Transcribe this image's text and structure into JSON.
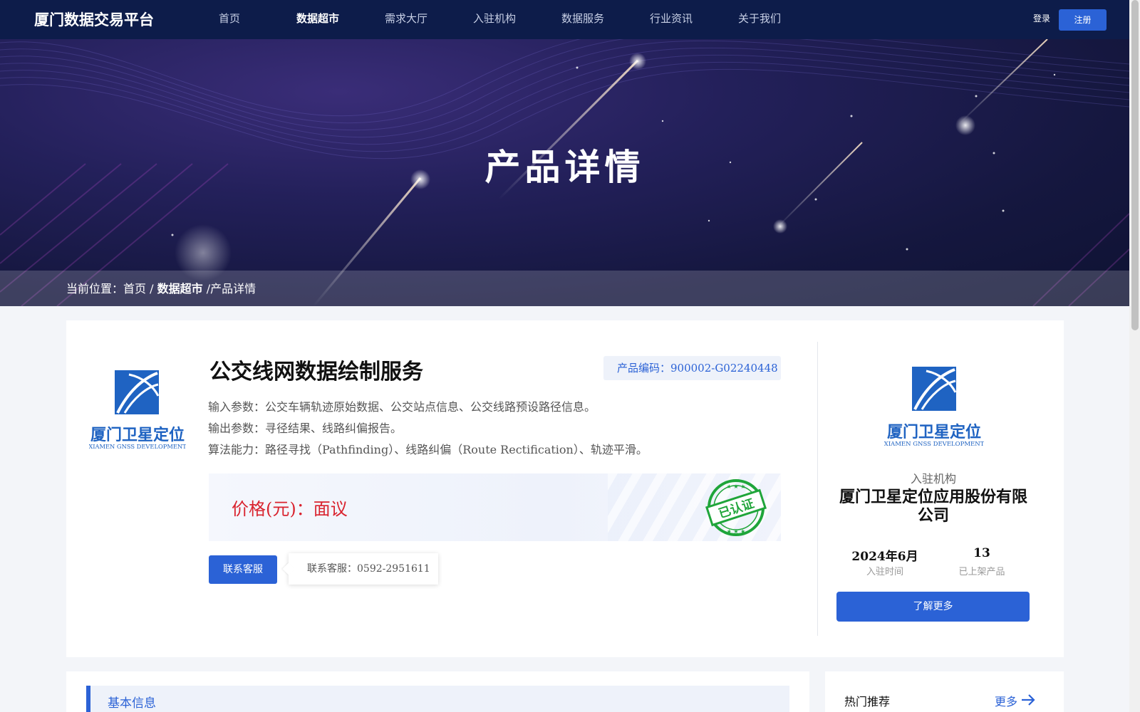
{
  "nav": {
    "brand": "厦门数据交易平台",
    "items": [
      "首页",
      "数据超市",
      "需求大厅",
      "入驻机构",
      "数据服务",
      "行业资讯",
      "关于我们"
    ],
    "active_index": 1,
    "login": "登录",
    "register": "注册"
  },
  "hero": {
    "title": "产品详情"
  },
  "breadcrumb": {
    "prefix": "当前位置：",
    "home": "首页",
    "sep1": "/",
    "section": "数据超市",
    "sep2": "/",
    "current": "产品详情"
  },
  "product": {
    "title": "公交线网数据绘制服务",
    "code_label": "产品编码：900002-G02240448",
    "params": [
      "输入参数：公交车辆轨迹原始数据、公交站点信息、公交线路预设路径信息。",
      "输出参数：寻径结果、线路纠偏报告。",
      "算法能力：路径寻找（Pathfinding）、线路纠偏（Route Rectification）、轨迹平滑。"
    ],
    "price": "价格(元)：面议",
    "stamp_text": "已认证",
    "contact_button": "联系客服",
    "contact_tip": "联系客服：0592-2951611"
  },
  "logo": {
    "cn": "厦门卫星定位",
    "en": "XIAMEN GNSS DEVELOPMENT"
  },
  "org": {
    "label": "入驻机构",
    "name": "厦门卫星定位应用股份有限公司",
    "join_time_value": "2024年6月",
    "join_time_label": "入驻时间",
    "products_value": "13",
    "products_label": "已上架产品",
    "more_button": "了解更多"
  },
  "sections": {
    "basic_info": "基本信息",
    "hot": "热门推荐",
    "hot_more": "更多"
  },
  "colors": {
    "accent": "#2b62d6",
    "price": "#d9232e",
    "nav_bg": "#0d1c4a",
    "stamp": "#1fa53a"
  }
}
